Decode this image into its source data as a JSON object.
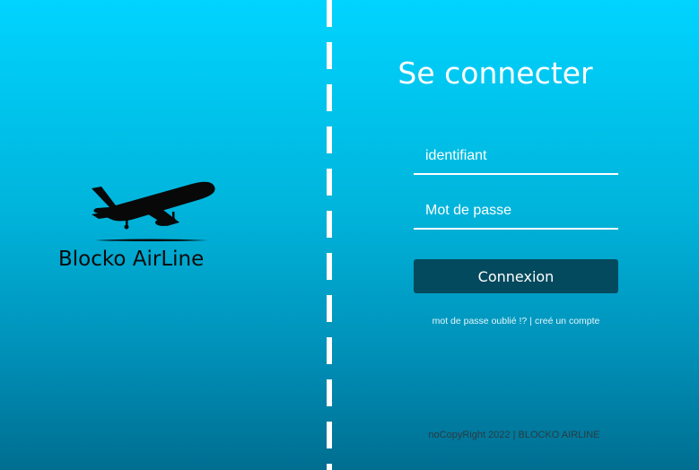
{
  "brand": {
    "name": "Blocko AirLine",
    "logo_icon": "airplane-takeoff-icon"
  },
  "login": {
    "title": "Se connecter",
    "username_placeholder": "identifiant",
    "password_placeholder": "Mot de passe",
    "submit_label": "Connexion",
    "forgot_password_link": "mot de passe oublié !?",
    "link_separator": "|",
    "create_account_link": "creé un compte"
  },
  "footer": {
    "text": "noCopyRight 2022 | BLOCKO AIRLINE"
  },
  "colors": {
    "background_top": "#00d4ff",
    "background_bottom": "#006e90",
    "button": "#044a5e",
    "text": "#ffffff"
  }
}
